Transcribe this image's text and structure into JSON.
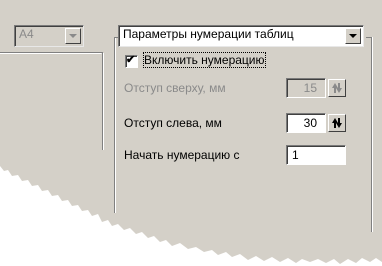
{
  "paper_size": {
    "value": "A4"
  },
  "params": {
    "dropdown_value": "Параметры нумерации таблиц",
    "enable_checkbox": {
      "label": "Включить нумерацию",
      "checked": true,
      "check_glyph": "✔"
    },
    "top_offset": {
      "label": "Отступ сверху, мм",
      "value": "15",
      "disabled": true
    },
    "left_offset": {
      "label": "Отступ слева, мм",
      "value": "30"
    },
    "start_number": {
      "label": "Начать нумерацию с",
      "value": "1"
    }
  },
  "colors": {
    "panel": "#d4d0c8",
    "disabled_text": "#8a8a8a"
  },
  "icons": {
    "dropdown": "chevron-down-icon",
    "spin": "spin-arrows-icon"
  }
}
